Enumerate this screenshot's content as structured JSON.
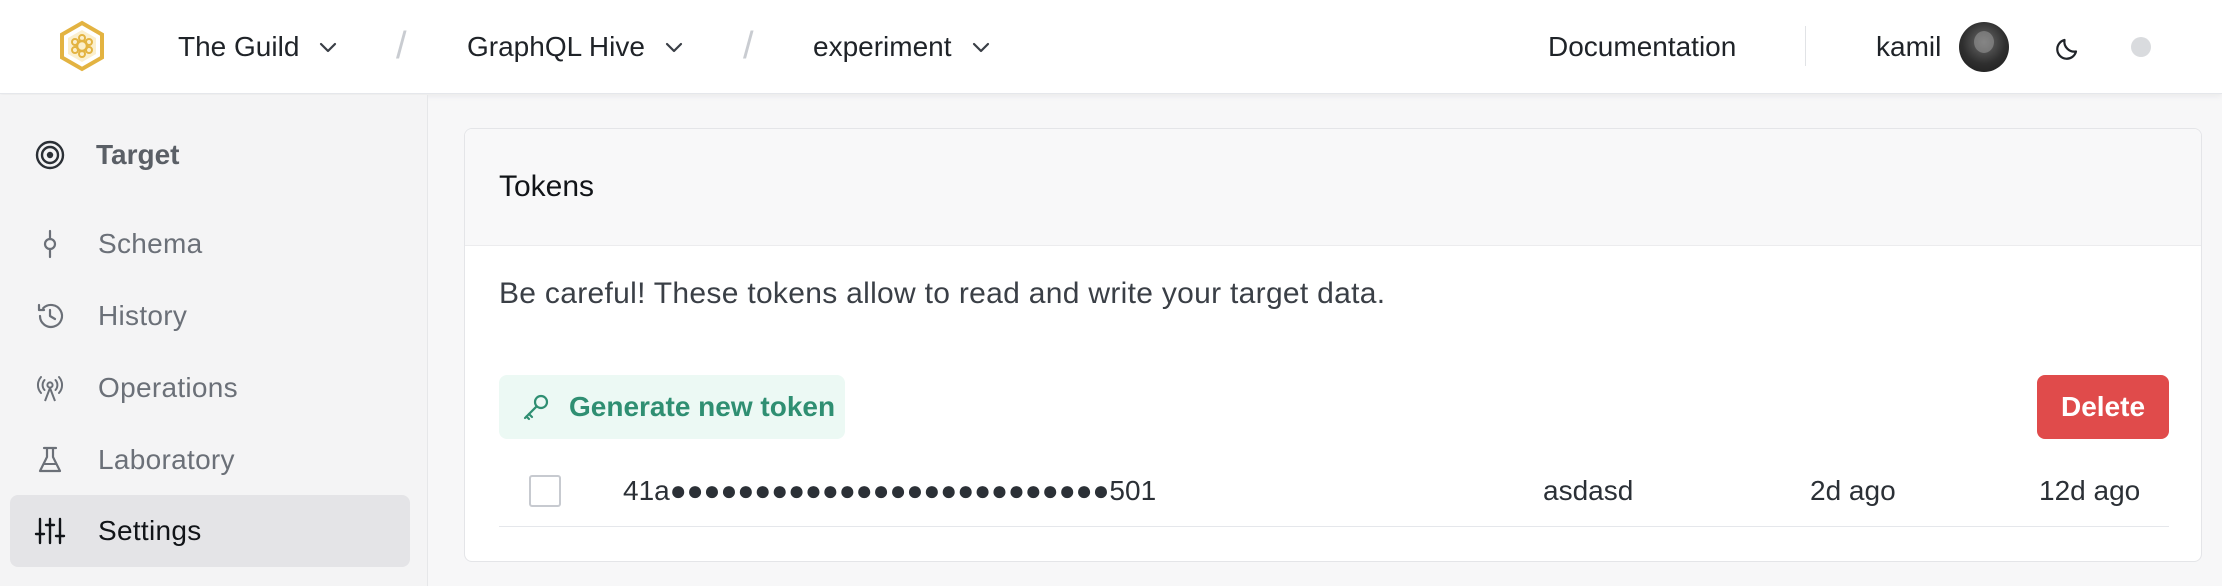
{
  "header": {
    "org": "The Guild",
    "project": "GraphQL Hive",
    "target": "experiment",
    "separator": "/",
    "documentation": "Documentation",
    "user": "kamil"
  },
  "sidebar": {
    "heading": "Target",
    "items": [
      {
        "label": "Schema",
        "icon": "schema-icon"
      },
      {
        "label": "History",
        "icon": "history-icon"
      },
      {
        "label": "Operations",
        "icon": "operations-icon"
      },
      {
        "label": "Laboratory",
        "icon": "flask-icon"
      },
      {
        "label": "Settings",
        "icon": "sliders-icon",
        "active": true
      }
    ]
  },
  "tokens_card": {
    "title": "Tokens",
    "description": "Be careful! These tokens allow to read and write your target data.",
    "generate_label": "Generate new token",
    "delete_label": "Delete",
    "rows": [
      {
        "token": "41a●●●●●●●●●●●●●●●●●●●●●●●●●●501",
        "name": "asdasd",
        "last_used": "2d ago",
        "created": "12d ago"
      }
    ]
  },
  "colors": {
    "logo": "#e3b341",
    "generate_bg": "#ecf9f4",
    "generate_text": "#2f8f72",
    "delete_bg": "#e04b4b",
    "active_item_bg": "#e4e4e7"
  }
}
